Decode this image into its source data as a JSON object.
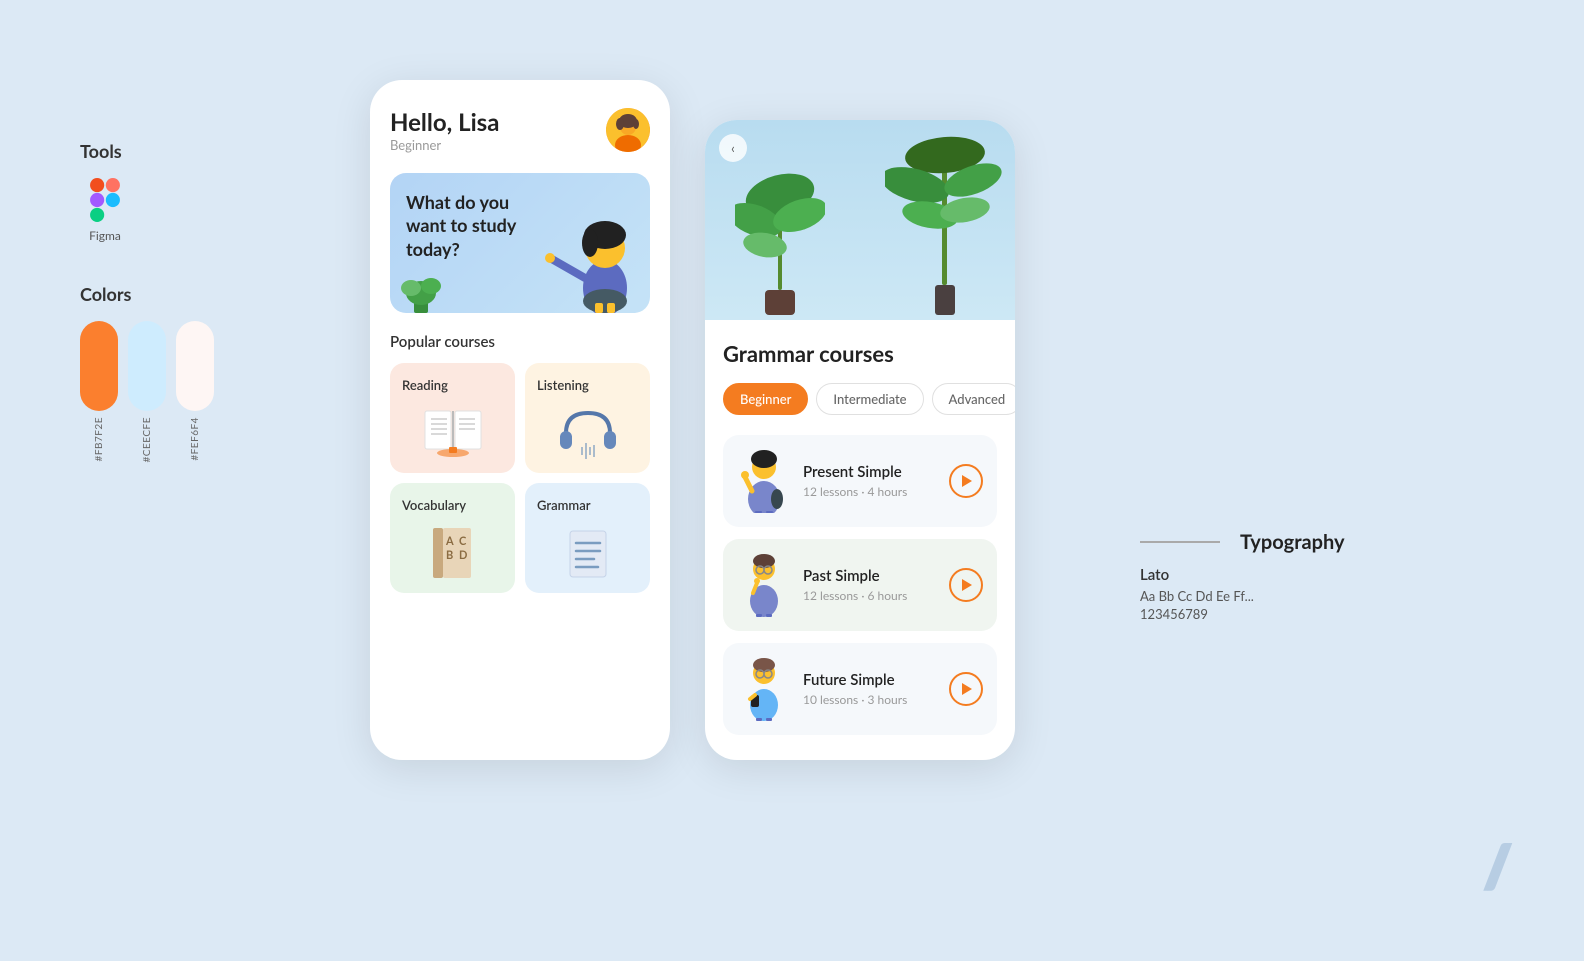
{
  "left": {
    "tools_title": "Tools",
    "figma_label": "Figma",
    "colors_title": "Colors",
    "swatches": [
      {
        "color": "#FB7F2E",
        "label": "#FB7F2E"
      },
      {
        "color": "#CEECFE",
        "label": "#CEECFE"
      },
      {
        "color": "#FEF6F4",
        "label": "#FEF6F4"
      }
    ]
  },
  "phone1": {
    "greeting": "Hello, Lisa",
    "level": "Beginner",
    "banner_text": "What do you want to study today?",
    "popular_courses_label": "Popular courses",
    "courses": [
      {
        "id": "reading",
        "title": "Reading",
        "bg": "#fce8e0"
      },
      {
        "id": "listening",
        "title": "Listening",
        "bg": "#fef3e2"
      },
      {
        "id": "vocabulary",
        "title": "Vocabulary",
        "bg": "#e8f5e9"
      },
      {
        "id": "grammar",
        "title": "Grammar",
        "bg": "#e3f0fb"
      }
    ]
  },
  "phone2": {
    "title": "Grammar courses",
    "tabs": [
      {
        "label": "Beginner",
        "active": true
      },
      {
        "label": "Intermediate",
        "active": false
      },
      {
        "label": "Advanced",
        "active": false
      }
    ],
    "lessons": [
      {
        "title": "Present Simple",
        "meta": "12 lessons · 4 hours",
        "highlighted": false
      },
      {
        "title": "Past Simple",
        "meta": "12 lessons · 6 hours",
        "highlighted": true
      },
      {
        "title": "Future Simple",
        "meta": "10 lessons · 3 hours",
        "highlighted": false
      }
    ]
  },
  "typography": {
    "title": "Typography",
    "font_name": "Lato",
    "sample": "Aa Bb Cc Dd Ee Ff...",
    "numbers": "123456789"
  },
  "deco": "//"
}
